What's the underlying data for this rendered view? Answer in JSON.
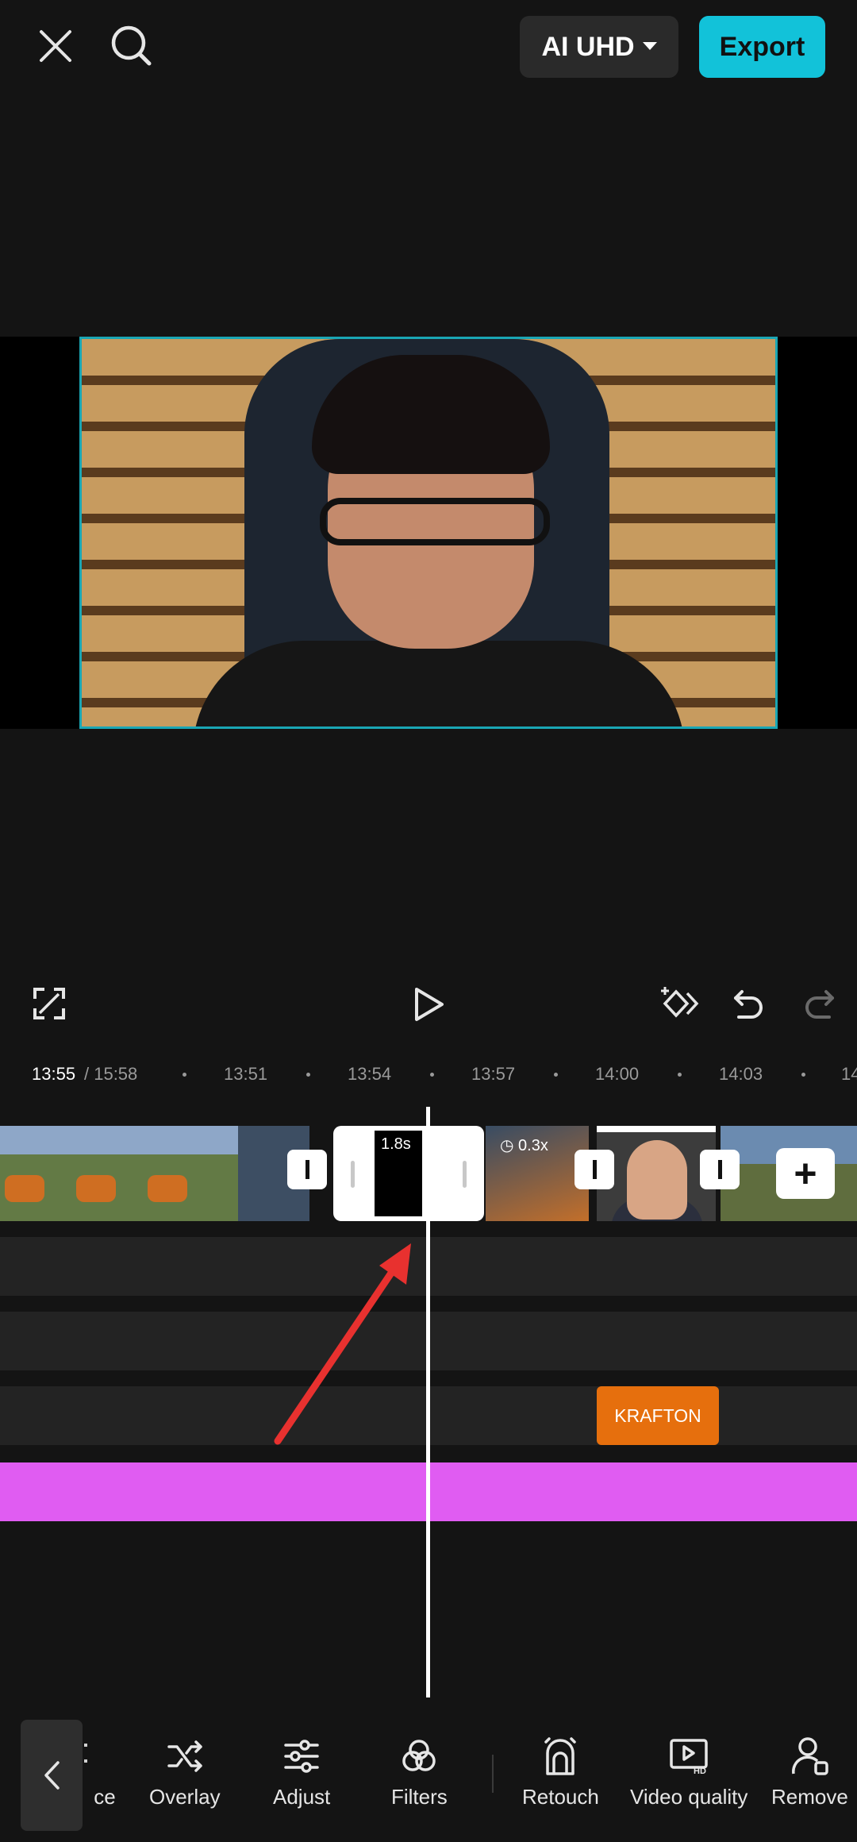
{
  "topbar": {
    "quality_label": "AI UHD",
    "export_label": "Export"
  },
  "timeline": {
    "current_time": "13:55",
    "total_time": "/ 15:58",
    "ticks": [
      "13:51",
      "13:54",
      "13:57",
      "14:00",
      "14:03",
      "14"
    ],
    "transition_duration": "1.8s",
    "speed_label": "0.3x",
    "sticker_label": "KRAFTON"
  },
  "toolbar": {
    "partial_label": "ce",
    "items": [
      "Overlay",
      "Adjust",
      "Filters",
      "Retouch",
      "Video quality",
      "Remove"
    ]
  },
  "colors": {
    "accent": "#12c2d9",
    "audio_track": "#e05cf2",
    "sticker": "#e66f0d",
    "annotation_arrow": "#e8312f"
  }
}
